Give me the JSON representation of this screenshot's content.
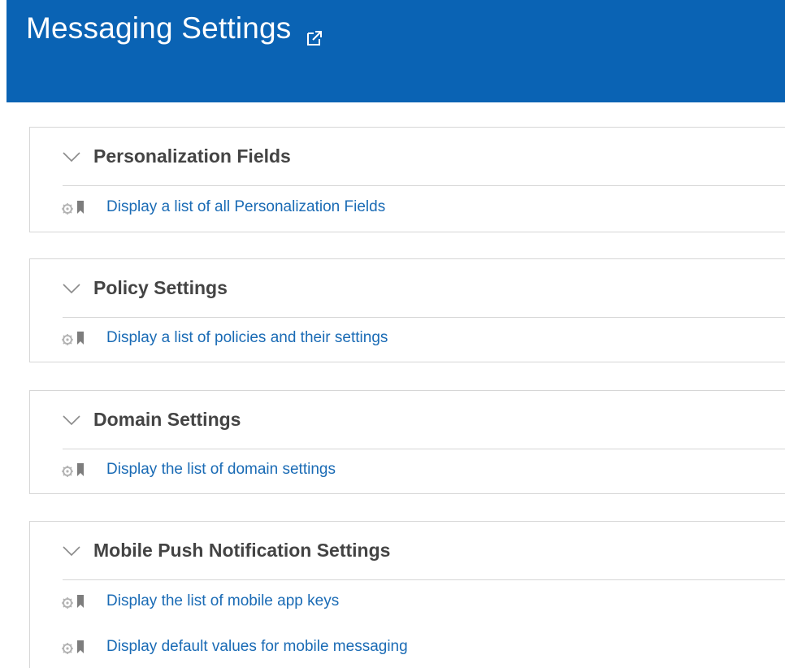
{
  "header": {
    "title": "Messaging Settings",
    "background_color": "#0a63b4",
    "open_icon": "external-link-icon"
  },
  "sections": [
    {
      "title": "Personalization Fields",
      "links": [
        "Display a list of all Personalization Fields"
      ]
    },
    {
      "title": "Policy Settings",
      "links": [
        "Display a list of policies and their settings"
      ]
    },
    {
      "title": "Domain Settings",
      "links": [
        "Display the list of domain settings"
      ]
    },
    {
      "title": "Mobile Push Notification Settings",
      "links": [
        "Display the list of mobile app keys",
        "Display default values for mobile messaging"
      ]
    }
  ],
  "icons": {
    "section_toggle": "chevron-down-icon",
    "row_settings": "gear-icon",
    "row_bookmark": "bookmark-icon"
  },
  "colors": {
    "link": "#1a6bb5",
    "section_title": "#444444",
    "border": "#d6d6d6"
  }
}
